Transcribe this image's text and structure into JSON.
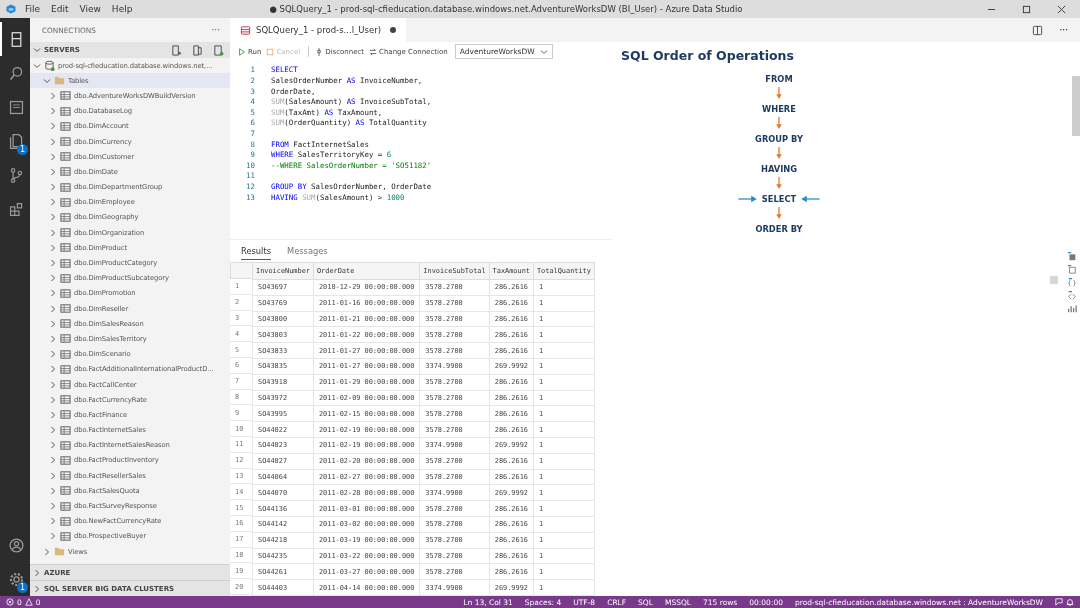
{
  "window": {
    "title": "● SQLQuery_1 - prod-sql-cfieducation.database.windows.net.AdventureWorksDW (BI_User) - Azure Data Studio"
  },
  "menu": [
    "File",
    "Edit",
    "View",
    "Help"
  ],
  "activity": [
    {
      "kind": "connections",
      "selected": true
    },
    {
      "kind": "search",
      "selected": false
    },
    {
      "kind": "notebook",
      "selected": false
    },
    {
      "kind": "files",
      "selected": false,
      "badge": "1"
    },
    {
      "kind": "git",
      "selected": false
    },
    {
      "kind": "extensions",
      "selected": false
    }
  ],
  "activity_bottom": [
    {
      "kind": "account"
    },
    {
      "kind": "gear",
      "badge": "1"
    }
  ],
  "sidebar": {
    "title": "CONNECTIONS",
    "more": "···",
    "section": "SERVERS",
    "server": "prod-sql-cfieducation.database.windows.net,...",
    "folder": "Tables",
    "tables": [
      "dbo.AdventureWorksDWBuildVersion",
      "dbo.DatabaseLog",
      "dbo.DimAccount",
      "dbo.DimCurrency",
      "dbo.DimCustomer",
      "dbo.DimDate",
      "dbo.DimDepartmentGroup",
      "dbo.DimEmployee",
      "dbo.DimGeography",
      "dbo.DimOrganization",
      "dbo.DimProduct",
      "dbo.DimProductCategory",
      "dbo.DimProductSubcategory",
      "dbo.DimPromotion",
      "dbo.DimReseller",
      "dbo.DimSalesReason",
      "dbo.DimSalesTerritory",
      "dbo.DimScenario",
      "dbo.FactAdditionalInternationalProductD...",
      "dbo.FactCallCenter",
      "dbo.FactCurrencyRate",
      "dbo.FactFinance",
      "dbo.FactInternetSales",
      "dbo.FactInternetSalesReason",
      "dbo.FactProductInventory",
      "dbo.FactResellerSales",
      "dbo.FactSalesQuota",
      "dbo.FactSurveyResponse",
      "dbo.NewFactCurrencyRate",
      "dbo.ProspectiveBuyer"
    ],
    "folder2": "Views",
    "bottom_sections": [
      "AZURE",
      "SQL SERVER BIG DATA CLUSTERS"
    ]
  },
  "tab": {
    "label": "SQLQuery_1 - prod-s...l_User)",
    "dirty": true
  },
  "toolbar": {
    "run": "Run",
    "cancel": "Cancel",
    "disconnect": "Disconnect",
    "change": "Change Connection",
    "database": "AdventureWorksDW"
  },
  "code": [
    {
      "n": "1",
      "tokens": [
        {
          "t": "SELECT",
          "kind": "keyword"
        }
      ]
    },
    {
      "n": "2",
      "tokens": [
        {
          "t": "SalesOrderNumber ",
          "kind": "identifier"
        },
        {
          "t": "AS",
          "kind": "keyword"
        },
        {
          "t": " InvoiceNumber,",
          "kind": "identifier"
        }
      ]
    },
    {
      "n": "3",
      "tokens": [
        {
          "t": "OrderDate,",
          "kind": "identifier"
        }
      ]
    },
    {
      "n": "4",
      "tokens": [
        {
          "t": "SUM",
          "kind": "function"
        },
        {
          "t": "(SalesAmount) ",
          "kind": "identifier"
        },
        {
          "t": "AS",
          "kind": "keyword"
        },
        {
          "t": " InvoiceSubTotal,",
          "kind": "identifier"
        }
      ]
    },
    {
      "n": "5",
      "tokens": [
        {
          "t": "SUM",
          "kind": "function"
        },
        {
          "t": "(TaxAmt) ",
          "kind": "identifier"
        },
        {
          "t": "AS",
          "kind": "keyword"
        },
        {
          "t": " TaxAmount,",
          "kind": "identifier"
        }
      ]
    },
    {
      "n": "6",
      "tokens": [
        {
          "t": "SUM",
          "kind": "function"
        },
        {
          "t": "(OrderQuantity) ",
          "kind": "identifier"
        },
        {
          "t": "AS",
          "kind": "keyword"
        },
        {
          "t": " TotalQuantity",
          "kind": "identifier"
        }
      ]
    },
    {
      "n": "7"
    },
    {
      "n": "8",
      "tokens": [
        {
          "t": "FROM",
          "kind": "keyword"
        },
        {
          "t": " FactInternetSales",
          "kind": "identifier"
        }
      ]
    },
    {
      "n": "9",
      "tokens": [
        {
          "t": "WHERE",
          "kind": "keyword"
        },
        {
          "t": " SalesTerritoryKey = ",
          "kind": "identifier"
        },
        {
          "t": "6",
          "kind": "number"
        }
      ]
    },
    {
      "n": "10",
      "tokens": [
        {
          "t": "--WHERE SalesOrderNumber = 'SO51182'",
          "kind": "comment"
        }
      ]
    },
    {
      "n": "11"
    },
    {
      "n": "12",
      "tokens": [
        {
          "t": "GROUP BY",
          "kind": "keyword"
        },
        {
          "t": " SalesOrderNumber, OrderDate",
          "kind": "identifier"
        }
      ]
    },
    {
      "n": "13",
      "tokens": [
        {
          "t": "HAVING ",
          "kind": "keyword"
        },
        {
          "t": "SUM",
          "kind": "function"
        },
        {
          "t": "(SalesAmount) > ",
          "kind": "identifier"
        },
        {
          "t": "1000",
          "kind": "number"
        }
      ]
    }
  ],
  "result_tabs": [
    {
      "label": "Results",
      "selected": true
    },
    {
      "label": "Messages",
      "selected": false
    }
  ],
  "table": {
    "columns": [
      "InvoiceNumber",
      "OrderDate",
      "InvoiceSubTotal",
      "TaxAmount",
      "TotalQuantity"
    ],
    "rows": [
      {
        "n": "1",
        "cells": [
          "SO43697",
          "2010-12-29 00:00:00.000",
          "3578.2700",
          "286.2616",
          "1"
        ]
      },
      {
        "n": "2",
        "cells": [
          "SO43769",
          "2011-01-16 00:00:00.000",
          "3578.2700",
          "286.2616",
          "1"
        ]
      },
      {
        "n": "3",
        "cells": [
          "SO43800",
          "2011-01-21 00:00:00.000",
          "3578.2700",
          "286.2616",
          "1"
        ]
      },
      {
        "n": "4",
        "cells": [
          "SO43803",
          "2011-01-22 00:00:00.000",
          "3578.2700",
          "286.2616",
          "1"
        ]
      },
      {
        "n": "5",
        "cells": [
          "SO43833",
          "2011-01-27 00:00:00.000",
          "3578.2700",
          "286.2616",
          "1"
        ]
      },
      {
        "n": "6",
        "cells": [
          "SO43835",
          "2011-01-27 00:00:00.000",
          "3374.9900",
          "269.9992",
          "1"
        ]
      },
      {
        "n": "7",
        "cells": [
          "SO43918",
          "2011-01-29 00:00:00.000",
          "3578.2700",
          "286.2616",
          "1"
        ]
      },
      {
        "n": "8",
        "cells": [
          "SO43972",
          "2011-02-09 00:00:00.000",
          "3578.2700",
          "286.2616",
          "1"
        ]
      },
      {
        "n": "9",
        "cells": [
          "SO43995",
          "2011-02-15 00:00:00.000",
          "3578.2700",
          "286.2616",
          "1"
        ]
      },
      {
        "n": "10",
        "cells": [
          "SO44022",
          "2011-02-19 00:00:00.000",
          "3578.2700",
          "286.2616",
          "1"
        ]
      },
      {
        "n": "11",
        "cells": [
          "SO44023",
          "2011-02-19 00:00:00.000",
          "3374.9900",
          "269.9992",
          "1"
        ]
      },
      {
        "n": "12",
        "cells": [
          "SO44027",
          "2011-02-20 00:00:00.000",
          "3578.2700",
          "286.2616",
          "1"
        ]
      },
      {
        "n": "13",
        "cells": [
          "SO44064",
          "2011-02-27 00:00:00.000",
          "3578.2700",
          "286.2616",
          "1"
        ]
      },
      {
        "n": "14",
        "cells": [
          "SO44070",
          "2011-02-28 00:00:00.000",
          "3374.9900",
          "269.9992",
          "1"
        ]
      },
      {
        "n": "15",
        "cells": [
          "SO44136",
          "2011-03-01 00:00:00.000",
          "3578.2700",
          "286.2616",
          "1"
        ]
      },
      {
        "n": "16",
        "cells": [
          "SO44142",
          "2011-03-02 00:00:00.000",
          "3578.2700",
          "286.2616",
          "1"
        ]
      },
      {
        "n": "17",
        "cells": [
          "SO44218",
          "2011-03-19 00:00:00.000",
          "3578.2700",
          "286.2616",
          "1"
        ]
      },
      {
        "n": "18",
        "cells": [
          "SO44235",
          "2011-03-22 00:00:00.000",
          "3578.2700",
          "286.2616",
          "1"
        ]
      },
      {
        "n": "19",
        "cells": [
          "SO44261",
          "2011-03-27 00:00:00.000",
          "3578.2700",
          "286.2616",
          "1"
        ]
      },
      {
        "n": "20",
        "cells": [
          "SO44403",
          "2011-04-14 00:00:00.000",
          "3374.9900",
          "269.9992",
          "1"
        ]
      }
    ]
  },
  "diagram": {
    "title": "SQL Order of Operations",
    "steps": [
      {
        "label": "FROM",
        "highlighted": false
      },
      {
        "label": "WHERE",
        "highlighted": false
      },
      {
        "label": "GROUP BY",
        "highlighted": false
      },
      {
        "label": "HAVING",
        "highlighted": false
      },
      {
        "label": "SELECT",
        "highlighted": true
      },
      {
        "label": "ORDER BY",
        "highlighted": false
      }
    ]
  },
  "status_bar": {
    "errors": "0",
    "warnings": "0",
    "items": [
      "Ln 13, Col 31",
      "Spaces: 4",
      "UTF-8",
      "CRLF",
      "SQL",
      "MSSQL",
      "715 rows",
      "00:00:00",
      "prod-sql-cfieducation.database.windows.net : AdventureWorksDW"
    ]
  }
}
